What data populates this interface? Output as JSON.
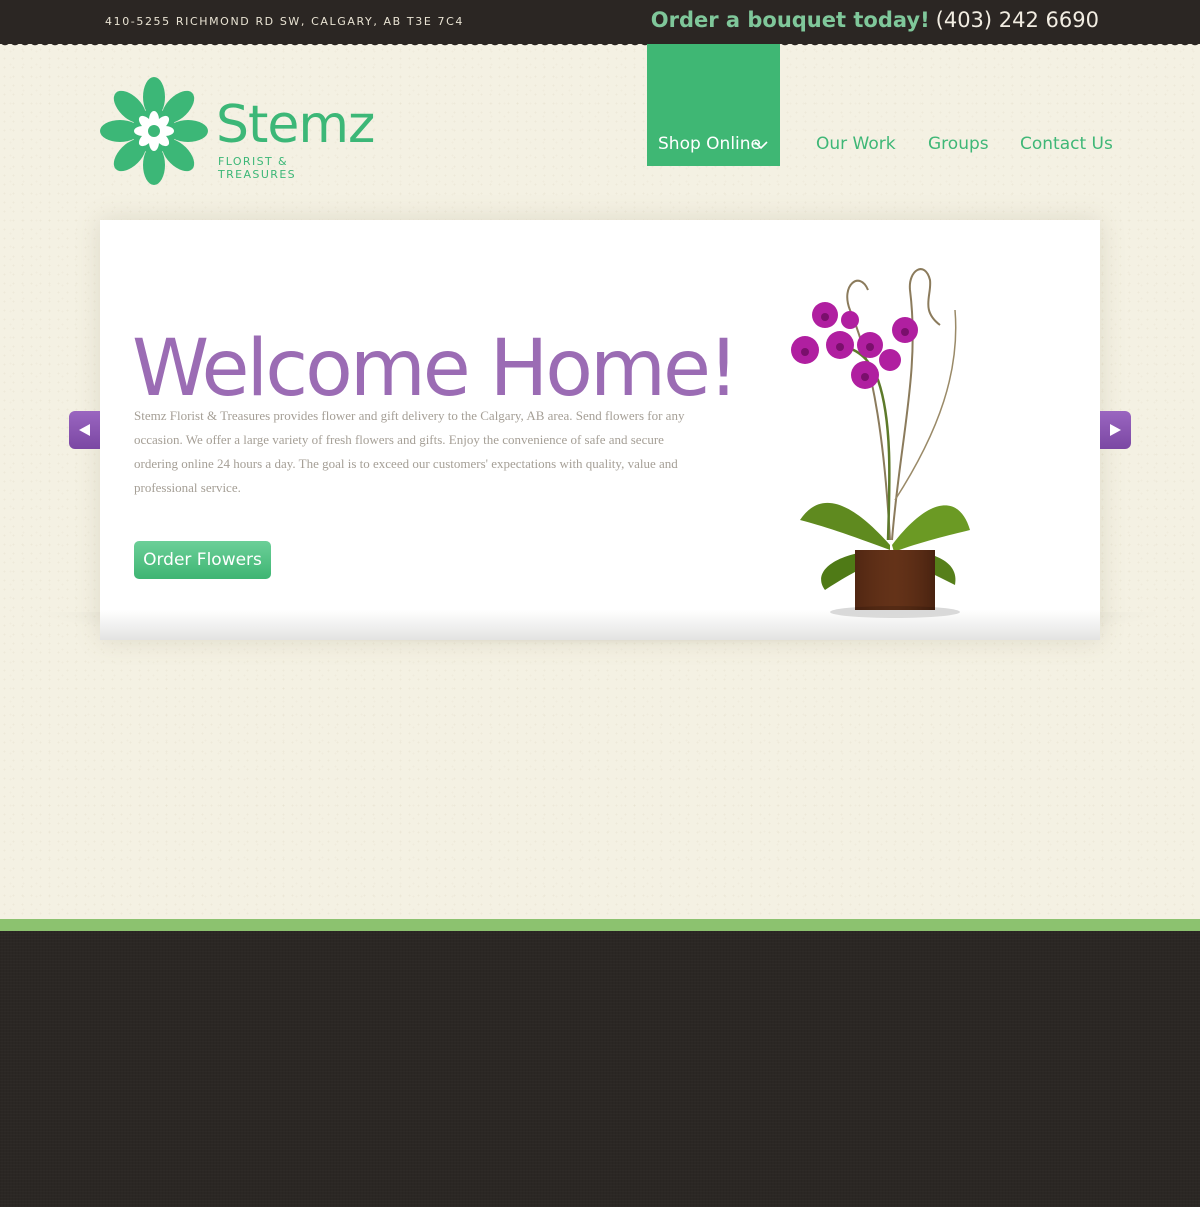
{
  "topbar": {
    "address": "410-5255 RICHMOND RD SW, CALGARY, AB T3E 7C4",
    "order_cta": "Order a bouquet today!",
    "phone": "(403) 242 6690"
  },
  "logo": {
    "name": "Stemz",
    "tagline": "FLORIST & TREASURES",
    "icon": "flower-logo-icon",
    "color": "#3cb777"
  },
  "nav": {
    "shop_online": "Shop Online",
    "our_work": "Our Work",
    "groups": "Groups",
    "contact_us": "Contact Us",
    "active_color": "#3fb774"
  },
  "hero": {
    "heading": "Welcome Home!",
    "intro": "Stemz Florist & Treasures provides flower and gift delivery to the Calgary, AB area. Send flowers for any occasion. We offer a large variety of fresh flowers and gifts. Enjoy the convenience of safe and secure ordering online 24 hours a day. The goal is to exceed our customers' expectations with quality, value and professional service.",
    "button": "Order Flowers",
    "image": "potted-orchid",
    "heading_color": "#9b6cb4"
  },
  "slider": {
    "prev_icon": "arrow-left-icon",
    "next_icon": "arrow-right-icon",
    "arrow_color": "#8a57b2"
  }
}
